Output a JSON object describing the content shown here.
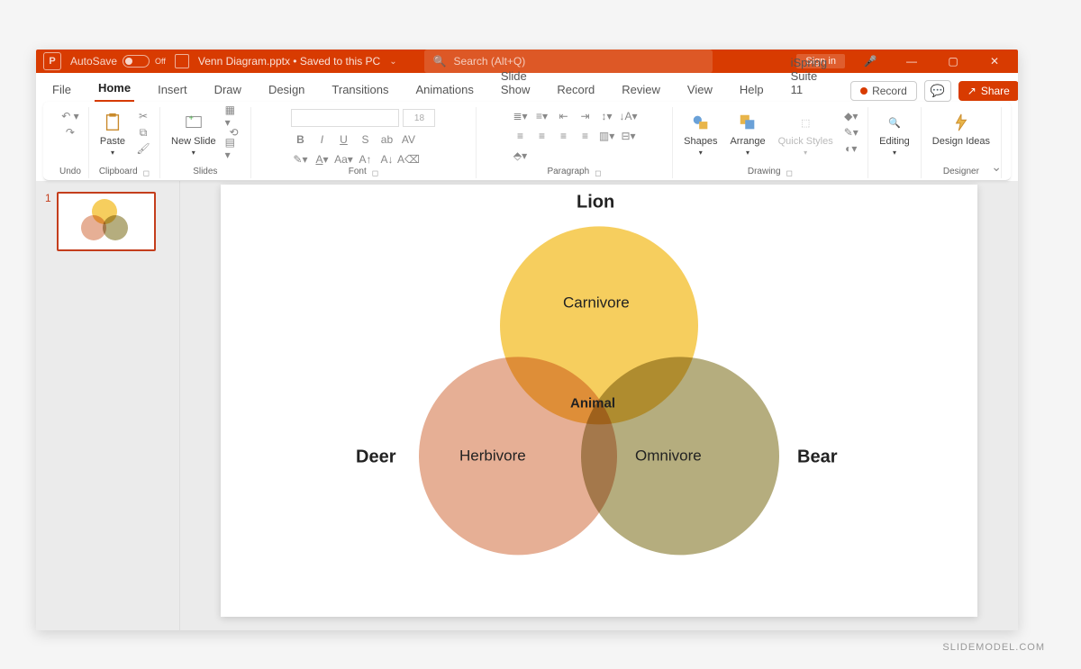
{
  "title": {
    "autosave": "AutoSave",
    "toggle": "Off",
    "filename": "Venn Diagram.pptx • Saved to this PC",
    "search_placeholder": "Search (Alt+Q)",
    "signin": "Sign in"
  },
  "tabs": {
    "file": "File",
    "home": "Home",
    "insert": "Insert",
    "draw": "Draw",
    "design": "Design",
    "transitions": "Transitions",
    "animations": "Animations",
    "slideshow": "Slide Show",
    "record": "Record",
    "review": "Review",
    "view": "View",
    "help": "Help",
    "ispring": "iSpring Suite 11",
    "record_btn": "Record",
    "share": "Share"
  },
  "ribbon": {
    "undo": "Undo",
    "clipboard": "Clipboard",
    "paste": "Paste",
    "slides": "Slides",
    "newslide": "New Slide",
    "font": "Font",
    "paragraph": "Paragraph",
    "drawing": "Drawing",
    "shapes": "Shapes",
    "arrange": "Arrange",
    "quickstyles": "Quick Styles",
    "editing": "Editing",
    "designer": "Designer",
    "designideas": "Design Ideas",
    "fontsize": "18"
  },
  "thumb": {
    "num": "1"
  },
  "venn": {
    "top": "Lion",
    "left": "Deer",
    "right": "Bear",
    "c1": "Carnivore",
    "c2": "Herbivore",
    "c3": "Omnivore",
    "center": "Animal"
  },
  "watermark": "SLIDEMODEL.COM"
}
